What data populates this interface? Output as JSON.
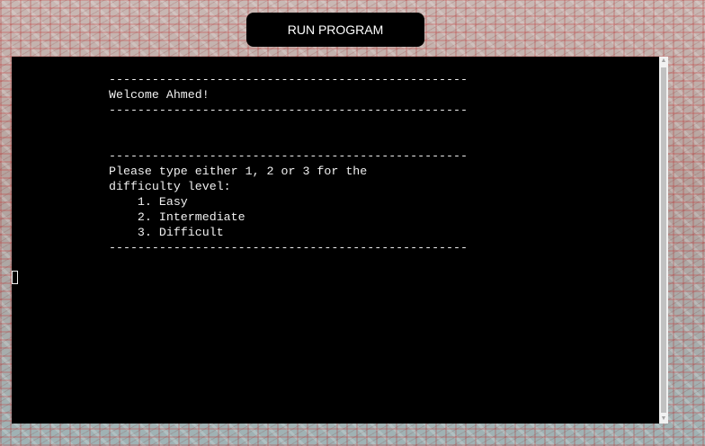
{
  "button": {
    "run_label": "RUN PROGRAM"
  },
  "terminal": {
    "lines": [
      "--------------------------------------------------",
      "Welcome Ahmed!",
      "--------------------------------------------------",
      "",
      "",
      "--------------------------------------------------",
      "Please type either 1, 2 or 3 for the",
      "difficulty level:",
      "    1. Easy",
      "    2. Intermediate",
      "    3. Difficult",
      "--------------------------------------------------"
    ],
    "input_value": ""
  },
  "scrollbar": {
    "up_icon": "triangle-up-icon",
    "down_icon": "triangle-down-icon"
  }
}
